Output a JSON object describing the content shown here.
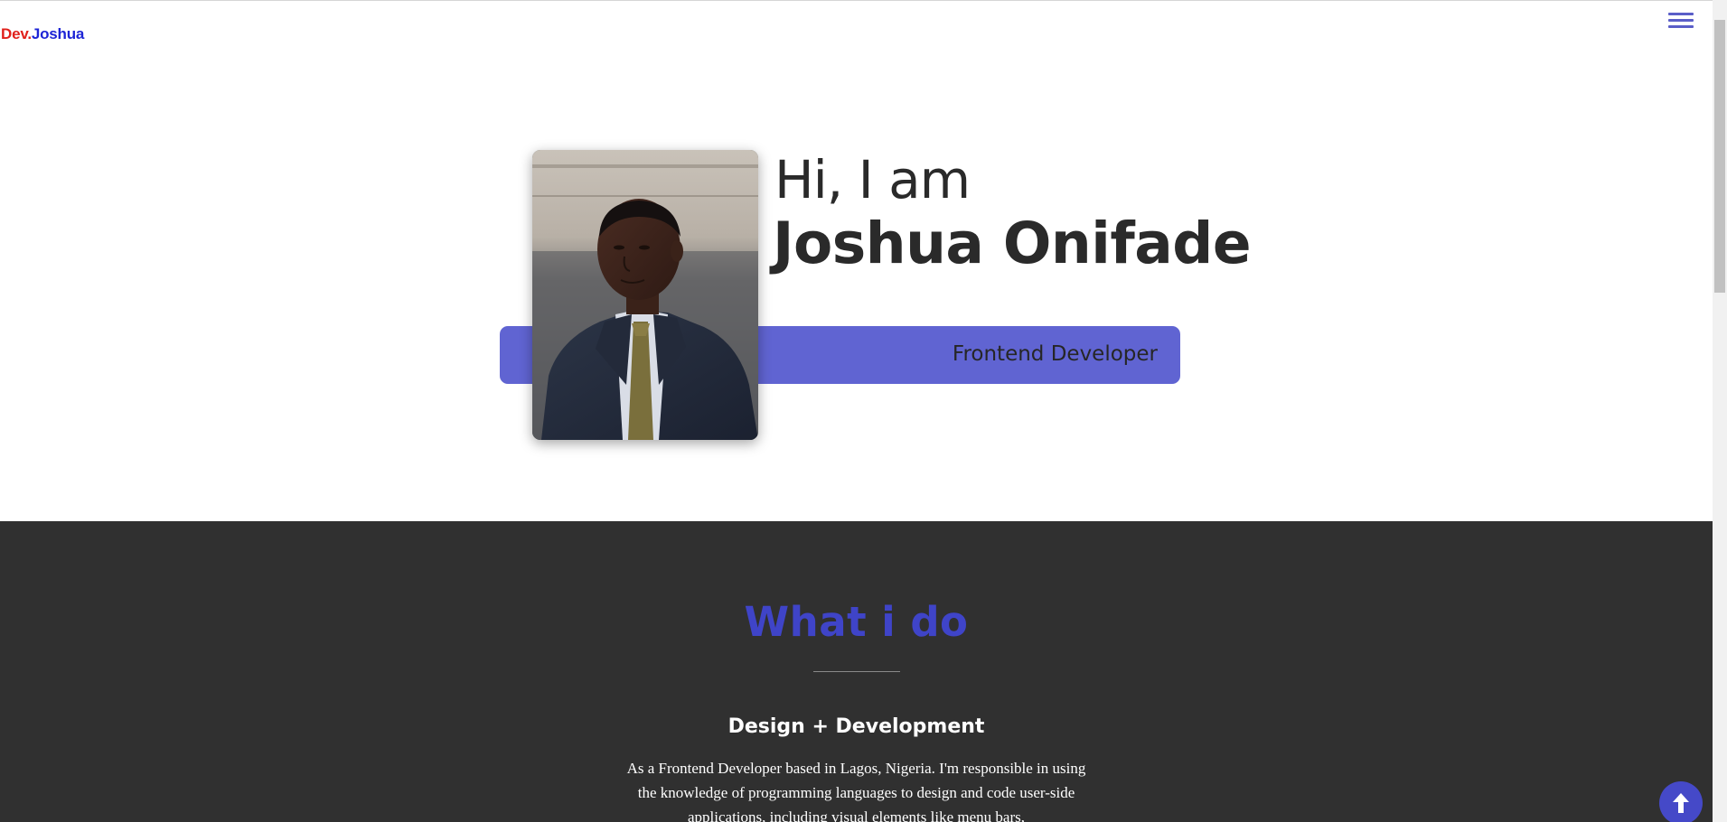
{
  "header": {
    "logo_prefix": "Dev.",
    "logo_name": "Joshua",
    "menu_icon": "hamburger-menu-icon"
  },
  "hero": {
    "greeting": "Hi, I am",
    "name": "Joshua Onifade",
    "role": "Frontend Developer",
    "accent_color": "#6064d2"
  },
  "what_i_do": {
    "title": "What i do",
    "title_color": "#3f44c8",
    "service_title": "Design + Development",
    "service_description": "As a Frontend Developer based in Lagos, Nigeria. I'm responsible in using the knowledge of programming languages to design and code user-side applications, including visual elements like menu bars,"
  },
  "back_to_top": {
    "icon": "arrow-up-icon"
  }
}
